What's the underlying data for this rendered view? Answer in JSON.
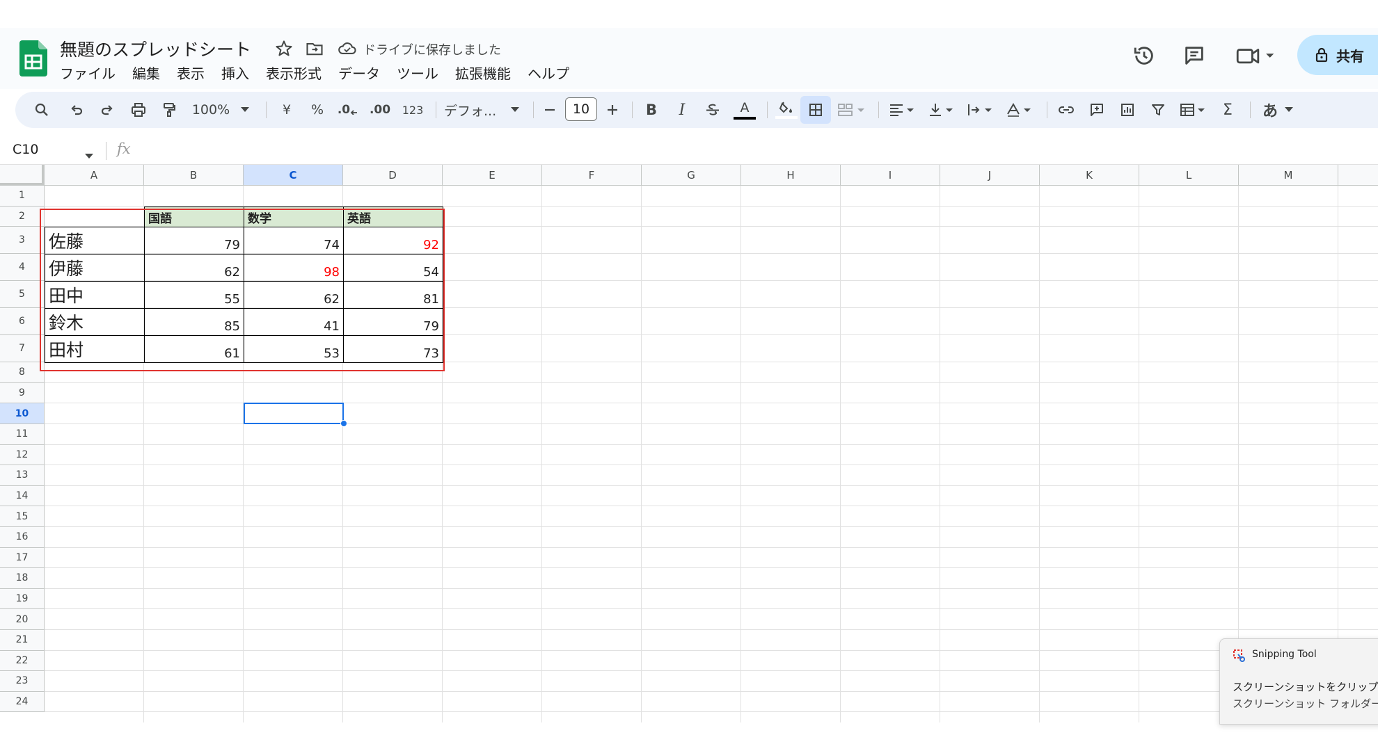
{
  "header": {
    "title": "無題のスプレッドシート",
    "save_status": "ドライブに保存しました",
    "share_label": "共有",
    "logo_icon": "sheets-logo-icon",
    "accent": "#0f9d58"
  },
  "menu": [
    "ファイル",
    "編集",
    "表示",
    "挿入",
    "表示形式",
    "データ",
    "ツール",
    "拡張機能",
    "ヘルプ"
  ],
  "toolbar": {
    "zoom": "100%",
    "currency": "¥",
    "percent": "%",
    "dec_decrease": ".0",
    "dec_increase": ".00",
    "number_format": "123",
    "font": "デフォ...",
    "font_size": "10",
    "bold": "B",
    "italic": "I",
    "text_color": "A",
    "input_tools": "あ",
    "sum": "Σ"
  },
  "formula_bar": {
    "cell_ref": "C10",
    "fx": "fx"
  },
  "grid": {
    "columns": [
      "A",
      "B",
      "C",
      "D",
      "E",
      "F",
      "G",
      "H",
      "I",
      "J",
      "K",
      "L",
      "M"
    ],
    "rows": [
      "1",
      "2",
      "3",
      "4",
      "5",
      "6",
      "7",
      "8",
      "9",
      "10",
      "11",
      "12",
      "13",
      "14",
      "15",
      "16",
      "17",
      "18",
      "19",
      "20",
      "21",
      "22",
      "23",
      "24"
    ],
    "selected_column": "C",
    "selected_row": "10"
  },
  "table": {
    "headers": [
      "国語",
      "数学",
      "英語"
    ],
    "rows": [
      {
        "name": "佐藤",
        "scores": [
          "79",
          "74",
          "92"
        ]
      },
      {
        "name": "伊藤",
        "scores": [
          "62",
          "98",
          "54"
        ]
      },
      {
        "name": "田中",
        "scores": [
          "55",
          "62",
          "81"
        ]
      },
      {
        "name": "鈴木",
        "scores": [
          "85",
          "41",
          "79"
        ]
      },
      {
        "name": "田村",
        "scores": [
          "61",
          "53",
          "73"
        ]
      }
    ],
    "highlight_color": "#ff0000",
    "header_fill": "#d9ead3",
    "frame_color": "#e0342f"
  },
  "toast": {
    "app": "Snipping Tool",
    "line1": "スクリーンショットをクリップボードにコ",
    "line2": "スクリーンショット フォルダーに自動"
  }
}
